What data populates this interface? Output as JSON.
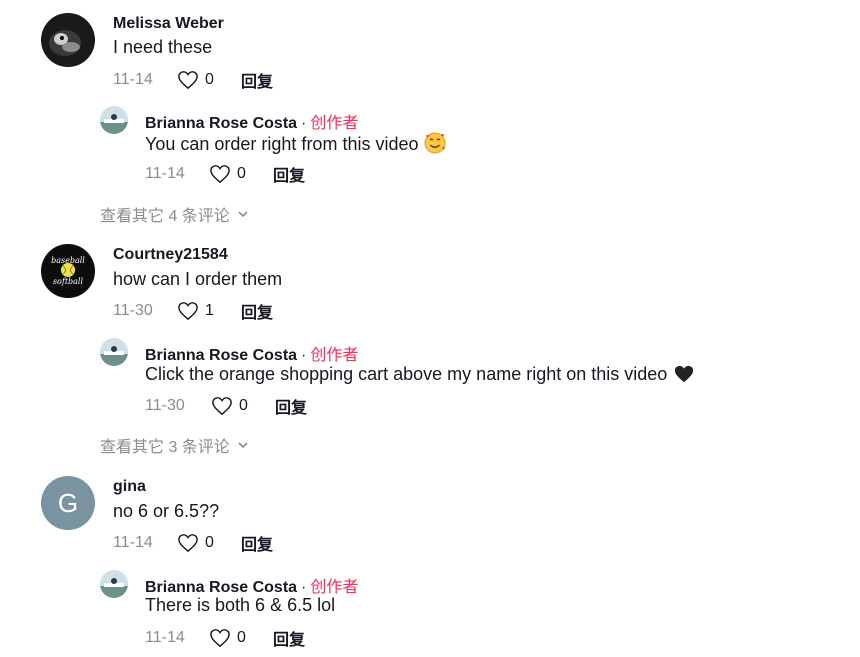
{
  "comments": [
    {
      "user": "Melissa Weber",
      "text": "I need these",
      "date": "11-14",
      "likes": "0",
      "reply_label": "回复",
      "reply": {
        "user": "Brianna Rose Costa",
        "separator": "·",
        "badge": "创作者",
        "text": "You can order right from this video",
        "emoji": "smiling-face-with-hearts-icon",
        "date": "11-14",
        "likes": "0",
        "reply_label": "回复"
      },
      "more": "查看其它 4 条评论"
    },
    {
      "user": "Courtney21584",
      "avatar_text": [
        "baseball",
        "softball"
      ],
      "text": "how can I order them",
      "date": "11-30",
      "likes": "1",
      "reply_label": "回复",
      "reply": {
        "user": "Brianna Rose Costa",
        "separator": "·",
        "badge": "创作者",
        "text": "Click the orange shopping cart above my name right on this video",
        "emoji": "black-heart-icon",
        "date": "11-30",
        "likes": "0",
        "reply_label": "回复"
      },
      "more": "查看其它 3 条评论"
    },
    {
      "user": "gina",
      "avatar_letter": "G",
      "text": "no 6 or 6.5??",
      "date": "11-14",
      "likes": "0",
      "reply_label": "回复",
      "reply": {
        "user": "Brianna Rose Costa",
        "separator": "·",
        "badge": "创作者",
        "text": "There is both 6 & 6.5 lol",
        "date": "11-14",
        "likes": "0",
        "reply_label": "回复"
      }
    }
  ],
  "colors": {
    "creator": "#fe2c55",
    "muted": "#8a8b91",
    "text": "#161823"
  }
}
